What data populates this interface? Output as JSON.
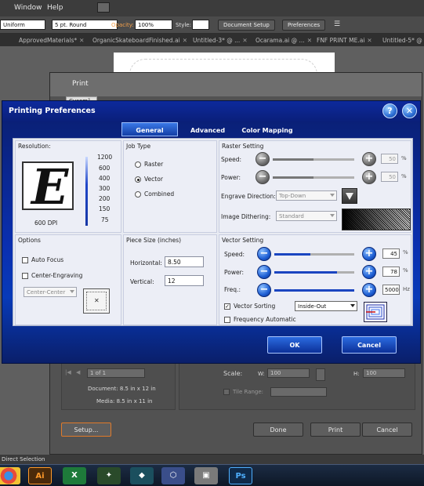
{
  "menubar": {
    "items": [
      "Window",
      "Help"
    ]
  },
  "controlbar": {
    "stroke_profile": "Uniform",
    "brush": "5 pt. Round",
    "opacity_label": "Opacity:",
    "opacity_value": "100%",
    "style_label": "Style:",
    "document_setup": "Document Setup",
    "preferences": "Preferences"
  },
  "doc_tabs": [
    "ApprovedMaterials*",
    "OrganicSkateboardFinished.ai",
    "Untitled-3* @ ...",
    "Ocarama.ai @ ...",
    "FNF PRINT ME.ai",
    "Untitled-5* @ ..."
  ],
  "print_dialog": {
    "title": "Print",
    "preset_value": "Cusom]",
    "page_value": "1 of 1",
    "document_size": "Document: 8.5 in x 12 in",
    "media_size": "Media: 8.5 in x 11 in",
    "scale_label": "Scale:",
    "w_label": "W:",
    "w_value": "100",
    "h_label": "H:",
    "h_value": "100",
    "tile_range_label": "Tile Range:",
    "setup_button": "Setup...",
    "done_button": "Done",
    "print_button": "Print",
    "cancel_button": "Cancel"
  },
  "prefs": {
    "title": "Printing Preferences",
    "help_icon_glyph": "?",
    "close_icon_glyph": "✕",
    "tabs": [
      "General",
      "Advanced",
      "Color Mapping"
    ],
    "resolution": {
      "title": "Resolution:",
      "preview_letter": "E",
      "dpi_label": "600 DPI",
      "options": [
        "1200",
        "600",
        "400",
        "300",
        "200",
        "150",
        "75"
      ]
    },
    "job_type": {
      "title": "Job Type",
      "options": [
        "Raster",
        "Vector",
        "Combined"
      ],
      "selected": "Vector"
    },
    "raster": {
      "title": "Raster Setting",
      "speed_label": "Speed:",
      "speed_value": "50",
      "power_label": "Power:",
      "power_value": "50",
      "percent": "%",
      "engrave_label": "Engrave Direction:",
      "engrave_value": "Top-Down",
      "dither_label": "Image Dithering:",
      "dither_value": "Standard"
    },
    "options": {
      "title": "Options",
      "auto_focus": "Auto Focus",
      "center_engraving": "Center-Engraving",
      "center_value": "Center-Center"
    },
    "piece_size": {
      "title": "Piece Size (inches)",
      "horizontal_label": "Horizontal:",
      "horizontal_value": "8.50",
      "vertical_label": "Vertical:",
      "vertical_value": "12"
    },
    "vector": {
      "title": "Vector Setting",
      "speed_label": "Speed:",
      "speed_value": "45",
      "power_label": "Power:",
      "power_value": "78",
      "freq_label": "Freq.:",
      "freq_value": "5000",
      "percent": "%",
      "hz": "Hz",
      "vector_sorting": "Vector Sorting",
      "sorting_value": "Inside-Out",
      "freq_auto": "Frequency Automatic"
    },
    "ok": "OK",
    "cancel": "Cancel"
  },
  "status": {
    "text": "Direct Selection"
  },
  "taskbar": {
    "apps": [
      "chrome-icon",
      "Ai",
      "excel-icon",
      "app-icon",
      "app-icon",
      "app-icon",
      "app-icon",
      "Ps"
    ]
  }
}
